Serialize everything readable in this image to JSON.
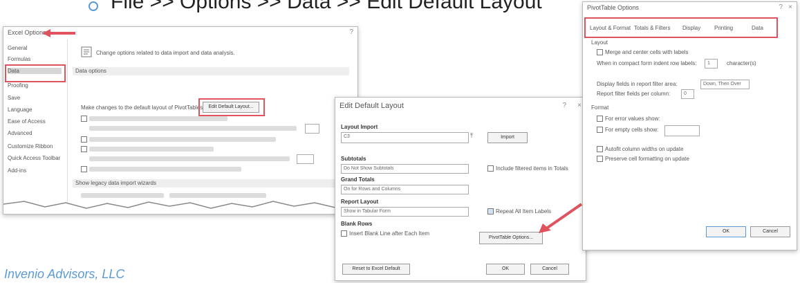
{
  "slide": {
    "title": "File >> Options >> Data >> Edit Default Layout",
    "footer": "Invenio Advisors, LLC"
  },
  "excel_options": {
    "title": "Excel Options",
    "sidebar": [
      "General",
      "Formulas",
      "Data",
      "Proofing",
      "Save",
      "Language",
      "Ease of Access",
      "Advanced",
      "Customize Ribbon",
      "Quick Access Toolbar",
      "Add-ins"
    ],
    "header_text": "Change options related to data import and data analysis.",
    "section_data_options": "Data options",
    "make_changes_text": "Make changes to the default layout of PivotTables:",
    "edit_default_layout_button": "Edit Default Layout...",
    "section_show_legacy": "Show legacy data import wizards"
  },
  "edit_default_layout": {
    "title": "Edit Default Layout",
    "layout_import_label": "Layout Import",
    "layout_import_value": "C3",
    "import_button": "Import",
    "subtotals_label": "Subtotals",
    "subtotals_value": "Do Not Show Subtotals",
    "include_filtered_label": "Include filtered items in Totals",
    "grand_totals_label": "Grand Totals",
    "grand_totals_value": "On for Rows and Columns",
    "report_layout_label": "Report Layout",
    "report_layout_value": "Show in Tabular Form",
    "repeat_labels_label": "Repeat All Item Labels",
    "blank_rows_label": "Blank Rows",
    "insert_blank_line_label": "Insert Blank Line after Each Item",
    "pivottable_options_button": "PivotTable Options...",
    "reset_button": "Reset to Excel Default",
    "ok_button": "OK",
    "cancel_button": "Cancel"
  },
  "pivot_options": {
    "title": "PivotTable Options",
    "tabs": [
      "Layout & Format",
      "Totals & Filters",
      "Display",
      "Printing",
      "Data"
    ],
    "layout_section": "Layout",
    "merge_label": "Merge and center cells with labels",
    "indent_label": "When in compact form indent row labels:",
    "indent_value": "1",
    "indent_unit": "character(s)",
    "display_fields_label": "Display fields in report filter area:",
    "display_fields_value": "Down, Then Over",
    "report_filter_fields_label": "Report filter fields per column:",
    "report_filter_fields_value": "0",
    "format_section": "Format",
    "error_values_label": "For error values show:",
    "empty_cells_label": "For empty cells show:",
    "autofit_label": "Autofit column widths on update",
    "preserve_label": "Preserve cell formatting on update",
    "ok_button": "OK",
    "cancel_button": "Cancel"
  },
  "colors": {
    "highlight_red": "#e0525e",
    "accent_blue": "#5b9bd5"
  }
}
